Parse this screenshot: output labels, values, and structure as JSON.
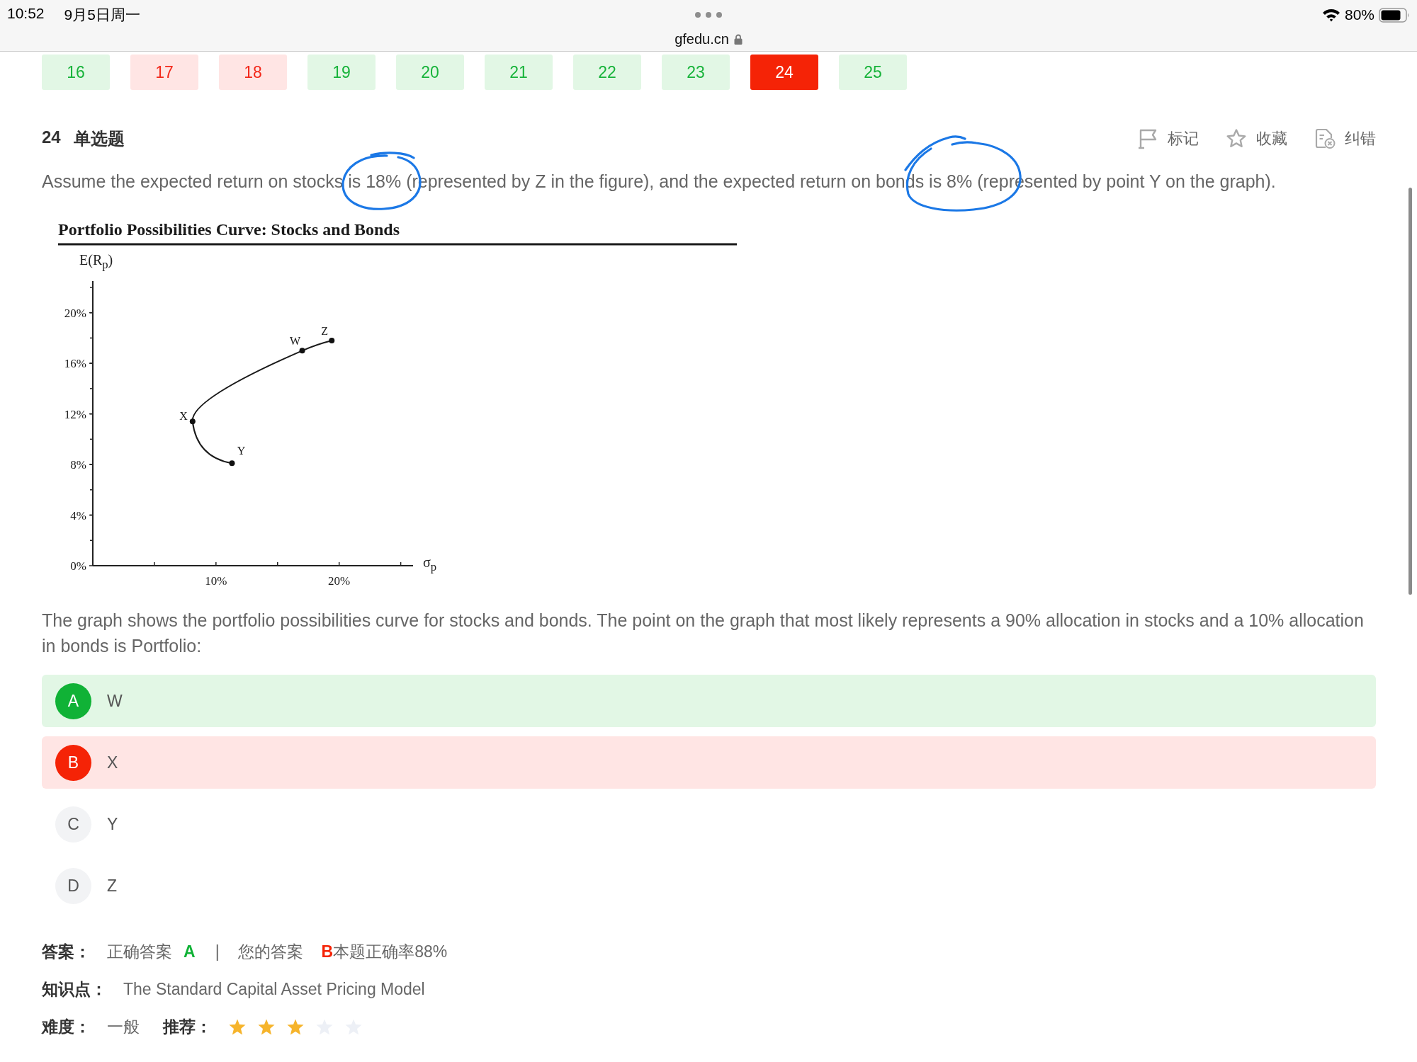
{
  "status_bar": {
    "time": "10:52",
    "date": "9月5日周一",
    "url": "gfedu.cn",
    "battery": "80%"
  },
  "question_nav": [
    {
      "label": "16",
      "correct": true,
      "selected": false
    },
    {
      "label": "17",
      "correct": false,
      "selected": false
    },
    {
      "label": "18",
      "correct": false,
      "selected": false
    },
    {
      "label": "19",
      "correct": true,
      "selected": false
    },
    {
      "label": "20",
      "correct": true,
      "selected": false
    },
    {
      "label": "21",
      "correct": true,
      "selected": false
    },
    {
      "label": "22",
      "correct": true,
      "selected": false
    },
    {
      "label": "23",
      "correct": true,
      "selected": false
    },
    {
      "label": "24",
      "correct": false,
      "selected": true
    },
    {
      "label": "25",
      "correct": true,
      "selected": false
    }
  ],
  "question": {
    "number": "24",
    "type": "单选题",
    "actions": [
      {
        "kind": "flag",
        "label": "标记"
      },
      {
        "kind": "star",
        "label": "收藏"
      },
      {
        "kind": "report",
        "label": "纠错"
      }
    ],
    "text": "Assume the expected return on stocks is 18% (represented by Z in the figure), and the expected return on bonds is 8% (represented by point Y on the graph).",
    "chart_data": {
      "type": "line",
      "title": "Portfolio Possibilities Curve: Stocks and Bonds",
      "xlabel": "σ$_{p}$",
      "ylabel": "E(R$_{p}$)",
      "x": [
        11.3,
        8.1,
        17.0,
        19.4
      ],
      "values": [
        8.1,
        11.4,
        17.0,
        17.8
      ],
      "marker": "circle",
      "xlim": [
        0,
        26
      ],
      "ylim": [
        0,
        22.5
      ],
      "xticks": [
        {
          "value": 10,
          "label": "10%"
        },
        {
          "value": 20,
          "label": "20%"
        }
      ],
      "yticks": [
        {
          "value": 0,
          "label": "0%"
        },
        {
          "value": 4,
          "label": "4%"
        },
        {
          "value": 8,
          "label": "8%"
        },
        {
          "value": 12,
          "label": "12%"
        },
        {
          "value": 16,
          "label": "16%"
        },
        {
          "value": 20,
          "label": "20%"
        }
      ],
      "annotations": [
        {
          "text": "Y",
          "x": 11.3,
          "y": 8.1
        },
        {
          "text": "X",
          "x": 8.1,
          "y": 11.4
        },
        {
          "text": "W",
          "x": 17.0,
          "y": 17.0
        },
        {
          "text": "Z",
          "x": 19.4,
          "y": 17.8
        }
      ]
    },
    "prompt": "The graph shows the portfolio possibilities curve for stocks and bonds. The point on the graph that most likely represents a 90% allocation in stocks and a 10% allocation in bonds is Portfolio:"
  },
  "options": [
    {
      "letter": "A",
      "text": "W",
      "correct": true,
      "selected": false
    },
    {
      "letter": "B",
      "text": "X",
      "correct": false,
      "selected": true
    },
    {
      "letter": "C",
      "text": "Y",
      "correct": false,
      "selected": false
    },
    {
      "letter": "D",
      "text": "Z",
      "correct": false,
      "selected": false
    }
  ],
  "answer": {
    "label": "答案：",
    "correct_label": "正确答案",
    "correct_value": "A",
    "separator": "|",
    "your_label": "您的答案",
    "your_value": "B",
    "accuracy": "本题正确率88%"
  },
  "knowledge_point": {
    "label": "知识点：",
    "value": "The Standard Capital Asset Pricing Model"
  },
  "difficulty": {
    "label": "难度：",
    "value": "一般"
  },
  "recommendation": {
    "label": "推荐：",
    "stars": 3
  }
}
